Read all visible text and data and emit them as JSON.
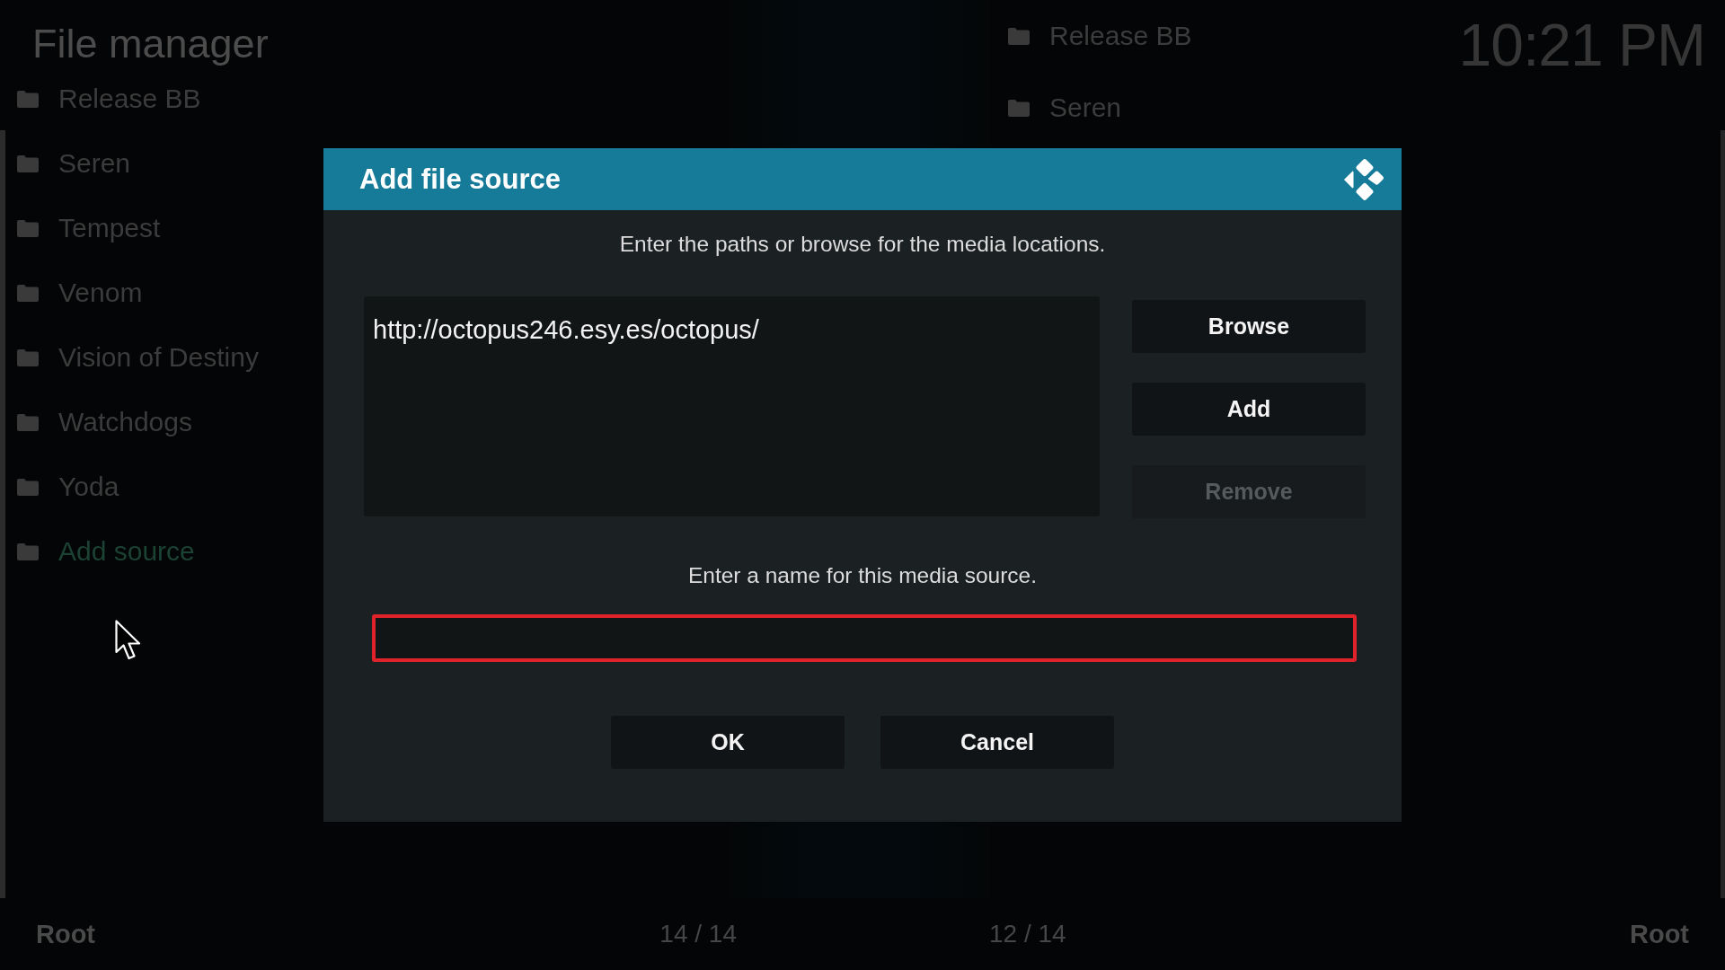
{
  "header": {
    "title": "File manager",
    "clock": "10:21 PM"
  },
  "left_panel": {
    "items": [
      {
        "label": "Release BB",
        "kind": "folder"
      },
      {
        "label": "Seren",
        "kind": "folder"
      },
      {
        "label": "Tempest",
        "kind": "folder"
      },
      {
        "label": "Venom",
        "kind": "folder"
      },
      {
        "label": "Vision of Destiny",
        "kind": "folder"
      },
      {
        "label": "Watchdogs",
        "kind": "folder"
      },
      {
        "label": "Yoda",
        "kind": "folder"
      },
      {
        "label": "Add source",
        "kind": "add"
      }
    ]
  },
  "right_panel": {
    "items": [
      {
        "label": "Release BB",
        "kind": "folder"
      },
      {
        "label": "Seren",
        "kind": "folder"
      }
    ]
  },
  "dialog": {
    "title": "Add file source",
    "instruction": "Enter the paths or browse for the media locations.",
    "paths": [
      "http://octopus246.esy.es/octopus/"
    ],
    "side_buttons": [
      {
        "label": "Browse",
        "disabled": false
      },
      {
        "label": "Add",
        "disabled": false
      },
      {
        "label": "Remove",
        "disabled": true
      }
    ],
    "name_label": "Enter a name for this media source.",
    "name_field": {
      "focused": true
    },
    "buttons": [
      "OK",
      "Cancel"
    ]
  },
  "footer": {
    "left_path": "Root",
    "left_count": "14 / 14",
    "right_count": "12 / 14",
    "right_path": "Root"
  }
}
